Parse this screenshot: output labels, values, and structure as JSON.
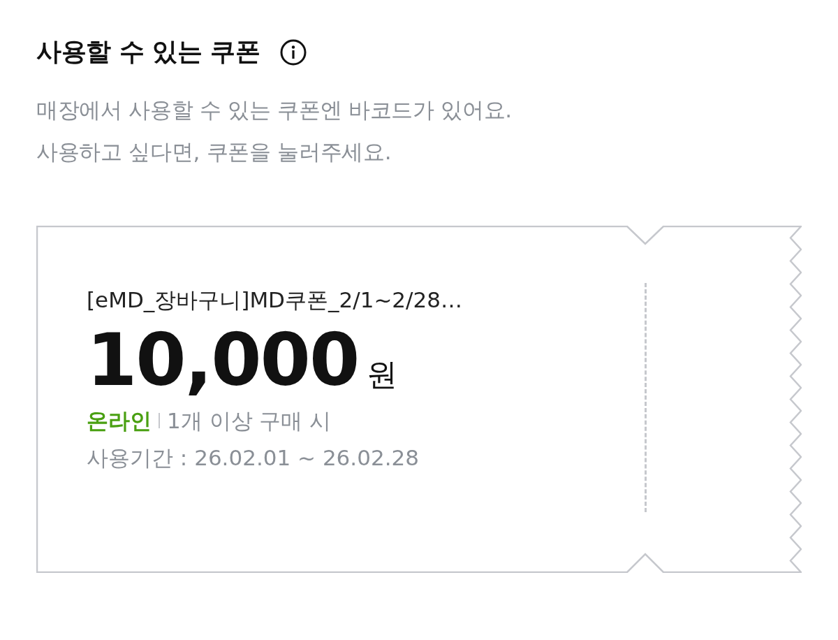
{
  "section": {
    "title": "사용할 수 있는 쿠폰"
  },
  "description": [
    "매장에서 사용할 수 있는 쿠폰엔 바코드가 있어요.",
    "사용하고 싶다면, 쿠폰을 눌러주세요."
  ],
  "coupons": [
    {
      "name": "[eMD_장바구니]MD쿠폰_2/1~2/28…",
      "amount": "10,000",
      "unit": "원",
      "channel": "온라인",
      "condition": "1개 이상 구매 시",
      "period": "사용기간 : 26.02.01 ~ 26.02.28"
    }
  ]
}
